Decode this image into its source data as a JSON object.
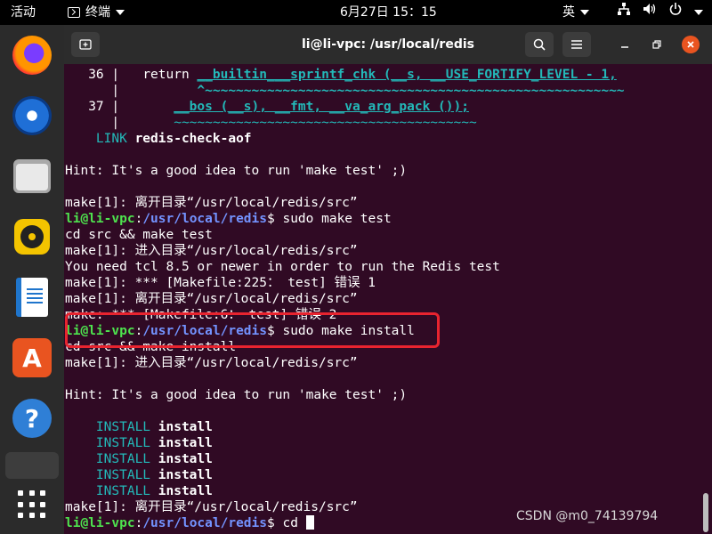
{
  "topbar": {
    "activities": "活动",
    "app_name": "终端",
    "clock": "6月27日 15：15",
    "input_method": "英"
  },
  "dock": {
    "items": [
      "firefox",
      "thunderbird",
      "files",
      "rhythmbox",
      "libreoffice-writer",
      "ubuntu-software",
      "help",
      "terminal",
      "show-applications"
    ]
  },
  "window": {
    "title": "li@li-vpc: /usr/local/redis"
  },
  "terminal": {
    "l1_num": "   36 |   ",
    "l1_code": "return ",
    "l1_fn": "__builtin___sprintf_chk (__s, __USE_FORTIFY_LEVEL - 1,",
    "l2_bar": "      |          ",
    "l2_tilde": "^~~~~~~~~~~~~~~~~~~~~~~~~~~~~~~~~~~~~~~~~~~~~~~~~~~~~~~",
    "l3_num": "   37 |       ",
    "l3_code": "__bos (__s), __fmt, __va_arg_pack ());",
    "l4_bar": "      |       ",
    "l4_tilde": "~~~~~~~~~~~~~~~~~~~~~~~~~~~~~~~~~~~~~~~",
    "l5_pre": "    LINK ",
    "l5_target": "redis-check-aof",
    "hint": "Hint: It's a good idea to run 'make test' ;)",
    "leave_dir": "make[1]: 离开目录“/usr/local/redis/src”",
    "prompt_user": "li@li-vpc",
    "prompt_path": "/usr/local/redis",
    "cmd_test": " sudo make test",
    "cd_test": "cd src && make test",
    "enter_dir": "make[1]: 进入目录“/usr/local/redis/src”",
    "tcl_msg": "You need tcl 8.5 or newer in order to run the Redis test",
    "err_225": "make[1]: *** [Makefile:225： test] 错误 1",
    "err_6": "make: *** [Makefile:6： test] 错误 2",
    "cmd_install": " sudo make install",
    "cd_install": "cd src && make install",
    "install_kw": "    INSTALL",
    "install_word": " install",
    "cmd_cd": " cd "
  },
  "watermark": "CSDN @m0_74139794",
  "colors": {
    "terminal_bg": "#300a24",
    "prompt_user": "#4ee24e",
    "prompt_path": "#7393ff",
    "highlight_box": "#e8242f",
    "close_button": "#e95420"
  }
}
